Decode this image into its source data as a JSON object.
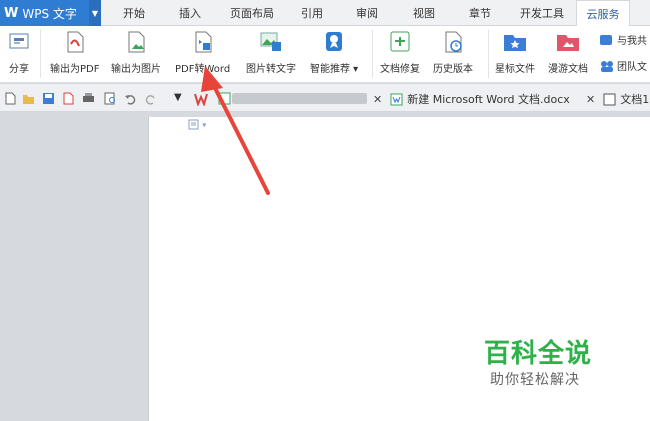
{
  "app": {
    "name": "WPS 文字",
    "logo": "W"
  },
  "menu": {
    "tabs": [
      {
        "label": "开始"
      },
      {
        "label": "插入"
      },
      {
        "label": "页面布局"
      },
      {
        "label": "引用"
      },
      {
        "label": "审阅"
      },
      {
        "label": "视图"
      },
      {
        "label": "章节"
      },
      {
        "label": "开发工具"
      },
      {
        "label": "云服务"
      }
    ],
    "active": "云服务"
  },
  "ribbon": {
    "share": "分享",
    "export_pdf": "输出为PDF",
    "export_image": "输出为图片",
    "pdf_to_word": "PDF转Word",
    "image_to_text": "图片转文字",
    "smart_recommend": "智能推荐",
    "doc_repair": "文档修复",
    "history": "历史版本",
    "starred": "星标文件",
    "roam_docs": "漫游文档",
    "share_with_me": "与我共",
    "team_docs": "团队文"
  },
  "doc_tabs": [
    {
      "label": "新建 Microsoft Word 文档.docx"
    },
    {
      "label": "文档1"
    }
  ],
  "watermark": {
    "title": "百科全说",
    "subtitle": "助你轻松解决"
  },
  "colors": {
    "accent": "#2f7cd3",
    "arrow": "#e8443a",
    "watermark": "#2fb14a"
  }
}
